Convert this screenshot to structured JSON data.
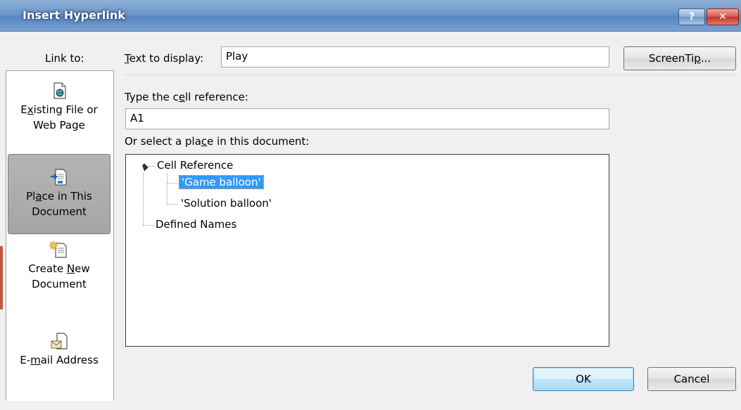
{
  "window": {
    "title": "Insert Hyperlink",
    "help_label": "?",
    "close_label": "✕"
  },
  "link_to": {
    "label": "Link to:",
    "places": [
      {
        "pre": "E",
        "ul": "x",
        "post": "isting File or",
        "line2": "Web Page",
        "icon": "globe-file-icon",
        "selected": false
      },
      {
        "pre": "Pl",
        "ul": "a",
        "post": "ce in This",
        "line2": "Document",
        "icon": "document-place-icon",
        "selected": true
      },
      {
        "pre": "Create ",
        "ul": "N",
        "post": "ew",
        "line2": "Document",
        "icon": "new-document-icon",
        "selected": false
      },
      {
        "pre": "E-",
        "ul": "m",
        "post": "ail Address",
        "line2": "",
        "icon": "email-icon",
        "selected": false
      }
    ]
  },
  "text_to_display": {
    "label_ul": "T",
    "label_rest": "ext to display:",
    "value": "Play"
  },
  "screentip": {
    "pre": "ScreenTi",
    "ul": "p",
    "post": "..."
  },
  "cell_reference": {
    "label_pre": "Type the c",
    "label_ul": "e",
    "label_post": "ll reference:",
    "value": "A1"
  },
  "place_select": {
    "label_pre": "Or select a pla",
    "label_ul": "c",
    "label_post": "e in this document:",
    "tree": {
      "root": "Cell Reference",
      "children": [
        "'Game balloon'",
        "'Solution balloon'"
      ],
      "selected_child": "'Game balloon'",
      "defined_names": "Defined Names"
    }
  },
  "buttons": {
    "ok": "OK",
    "cancel": "Cancel"
  }
}
